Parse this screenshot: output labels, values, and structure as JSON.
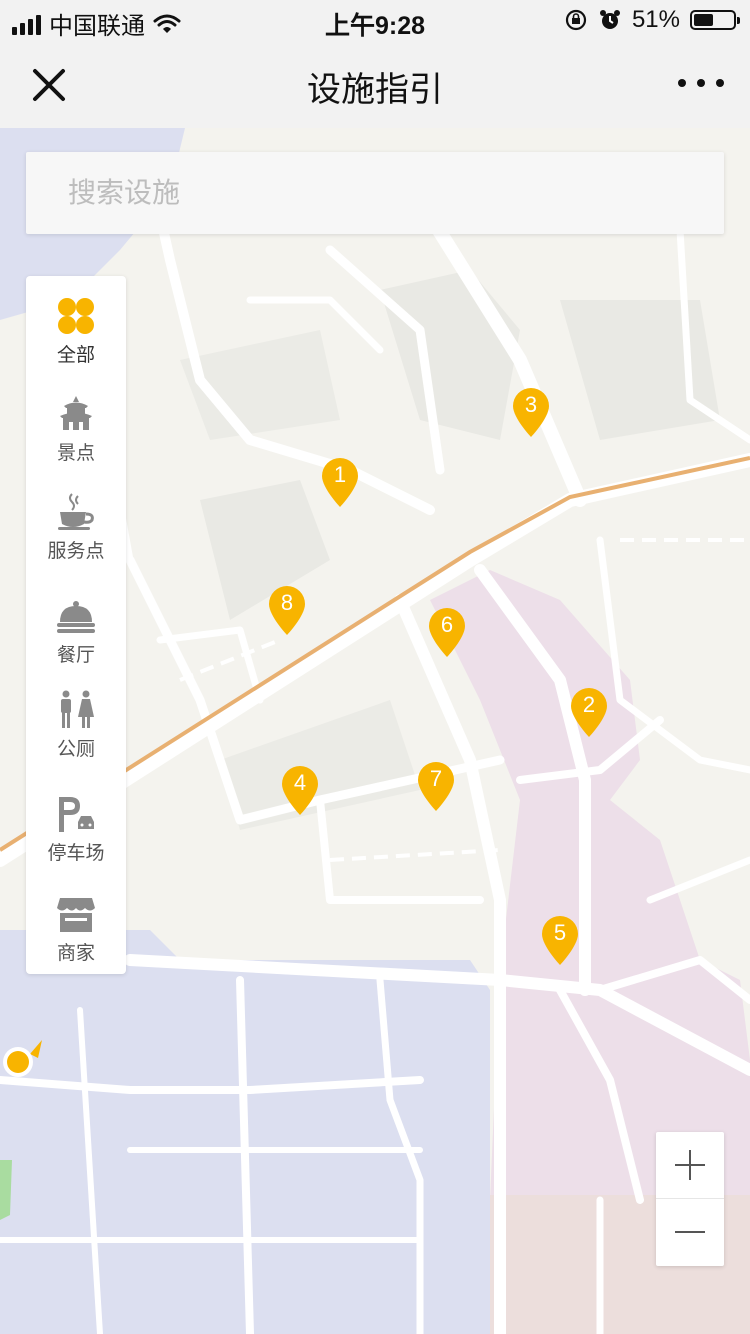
{
  "status": {
    "carrier": "中国联通",
    "time": "上午9:28",
    "battery_text": "51%",
    "battery_level": 0.51
  },
  "nav": {
    "title": "设施指引",
    "close_icon": "close-icon",
    "more_icon": "more-icon"
  },
  "search": {
    "placeholder": "搜索设施",
    "value": ""
  },
  "categories": [
    {
      "label": "全部",
      "icon": "grid-icon",
      "active": true
    },
    {
      "label": "景点",
      "icon": "pagoda-icon"
    },
    {
      "label": "服务点",
      "icon": "coffee-cup-icon"
    },
    {
      "label": "餐厅",
      "icon": "cloche-icon"
    },
    {
      "label": "公厕",
      "icon": "restroom-icon"
    },
    {
      "label": "停车场",
      "icon": "parking-icon"
    },
    {
      "label": "商家",
      "icon": "shop-icon"
    }
  ],
  "markers": [
    "1",
    "2",
    "3",
    "4",
    "5",
    "6",
    "7",
    "8"
  ],
  "colors": {
    "accent": "#f8b400",
    "land": "#f4f3ee",
    "road": "#ffffff",
    "water_zone": "#dcdff0",
    "pink_zone": "#eddfe9"
  },
  "zoom": {
    "in_icon": "plus-icon",
    "out_icon": "minus-icon"
  }
}
